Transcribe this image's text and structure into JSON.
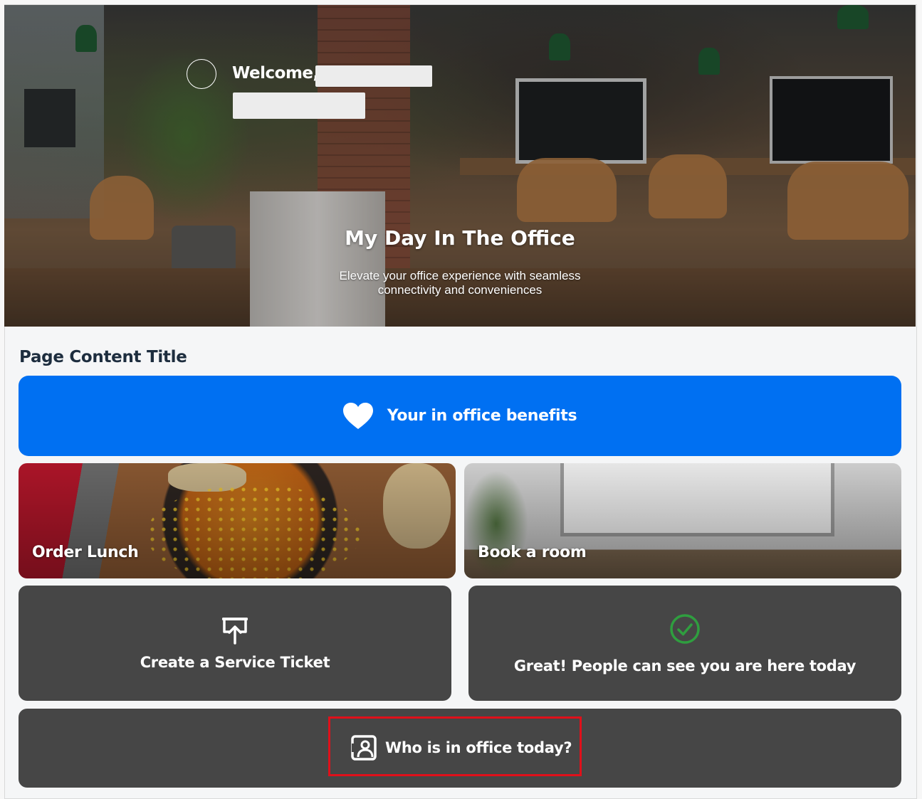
{
  "hero": {
    "welcome": "Welcome,",
    "title": "My Day In The Office",
    "subtitle": "Elevate your office experience with seamless connectivity and conveniences"
  },
  "page": {
    "title": "Page Content Title"
  },
  "tiles": {
    "benefits": {
      "label": "Your in office benefits",
      "icon": "heart-icon",
      "color": "#0070f2"
    },
    "lunch": {
      "label": "Order Lunch"
    },
    "room": {
      "label": "Book a room"
    },
    "ticket": {
      "label": "Create a Service Ticket",
      "icon": "presentation-upload-icon"
    },
    "presence": {
      "label": "Great! People can see you are here today",
      "icon": "check-circle-icon",
      "status_color": "#2f9e3f"
    },
    "who": {
      "label": "Who is in office today?",
      "icon": "person-card-icon"
    }
  },
  "colors": {
    "tile_dark": "#464646",
    "highlight": "#e0101a"
  }
}
